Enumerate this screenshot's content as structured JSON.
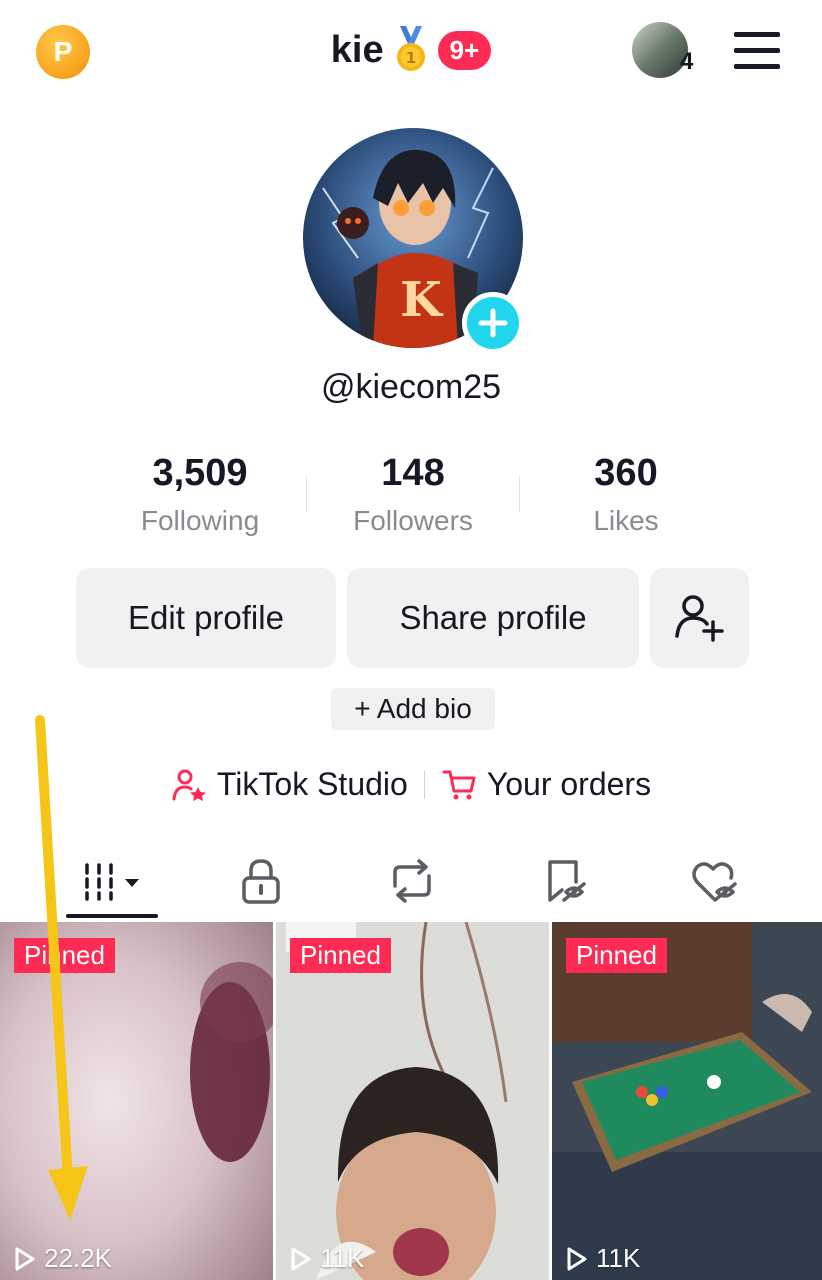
{
  "header": {
    "username": "kie",
    "notification_badge": "9+",
    "account_count": "4"
  },
  "profile": {
    "handle": "@kiecom25",
    "stats": [
      {
        "value": "3,509",
        "label": "Following"
      },
      {
        "value": "148",
        "label": "Followers"
      },
      {
        "value": "360",
        "label": "Likes"
      }
    ],
    "edit_label": "Edit profile",
    "share_label": "Share profile",
    "add_bio_label": "+ Add bio",
    "studio_label": "TikTok Studio",
    "orders_label": "Your orders"
  },
  "tabs": [
    "videos-grid-icon",
    "private-lock-icon",
    "repost-icon",
    "favorites-icon",
    "liked-icon"
  ],
  "videos": [
    {
      "pinned_label": "Pinned",
      "views": "22.2K"
    },
    {
      "pinned_label": "Pinned",
      "views": "11K"
    },
    {
      "pinned_label": "Pinned",
      "views": "11K"
    }
  ],
  "colors": {
    "accent": "#fe2c55",
    "plus_button": "#20d5ec",
    "annotation_arrow": "#f5c518"
  }
}
